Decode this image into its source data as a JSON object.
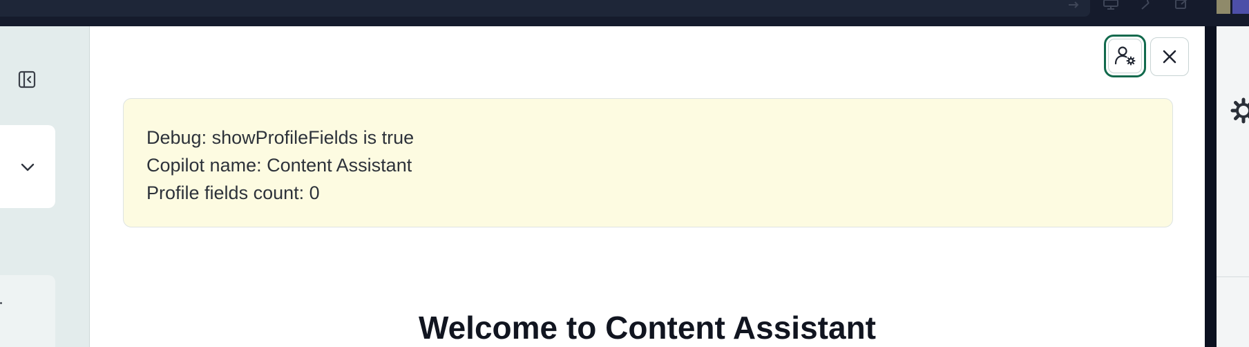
{
  "window": {
    "top_icons": [
      "arrow-right-icon",
      "monitor-icon",
      "wrench-icon",
      "external-link-icon"
    ]
  },
  "sidebar": {
    "collapse_icon": "panel-left-collapse-icon",
    "dropdown_icon": "chevron-down-icon"
  },
  "header": {
    "profile_settings_icon": "user-gear-icon",
    "close_icon": "close-icon"
  },
  "debug": {
    "line1": "Debug: showProfileFields is true",
    "line2": "Copilot name: Content Assistant",
    "line3": "Profile fields count: 0"
  },
  "main": {
    "welcome_title": "Welcome to Content Assistant"
  },
  "colors": {
    "accent": "#11694c",
    "debug_background": "#fdfbe1",
    "topbar": "#151b2c",
    "sidebar": "#e3ecec"
  }
}
